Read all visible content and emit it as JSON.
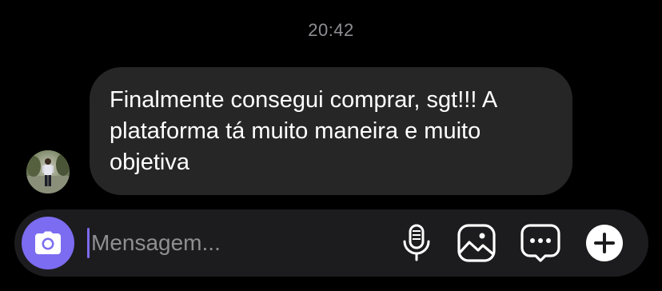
{
  "timestamp": "20:42",
  "message": {
    "text": "Finalmente consegui comprar, sgt!!! A plataforma tá muito maneira e muito objetiva",
    "lines": [
      "Finalmente consegui comprar, sgt!!! A",
      "plataforma tá muito maneira e muito",
      "objetiva"
    ],
    "bubble_color": "#262626"
  },
  "avatar": {
    "icon": "user-avatar-photo"
  },
  "composer": {
    "input_value": "",
    "input_placeholder": "Mensagem...",
    "camera_icon": "camera-icon",
    "mic_icon": "microphone-icon",
    "gallery_icon": "image-icon",
    "sticker_icon": "chat-bubble-dots-icon",
    "add_icon": "plus-circle-icon",
    "accent_color": "#7c6cf1"
  },
  "colors": {
    "background": "#000000",
    "composer_bg": "#1c1c1e",
    "timestamp": "#8e8e93"
  }
}
